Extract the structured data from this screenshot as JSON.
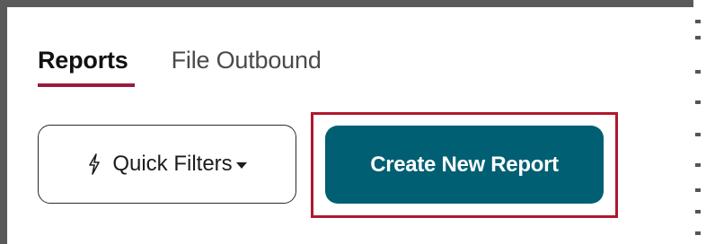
{
  "tabs": [
    {
      "label": "Reports",
      "active": true
    },
    {
      "label": "File Outbound",
      "active": false
    }
  ],
  "toolbar": {
    "quick_filters_label": "Quick Filters",
    "quick_filters_icon": "lightning-bolt-icon",
    "create_report_label": "Create New Report"
  },
  "colors": {
    "accent_underline": "#9b1b3d",
    "primary_button": "#005f73",
    "highlight_border": "#b0182c"
  }
}
